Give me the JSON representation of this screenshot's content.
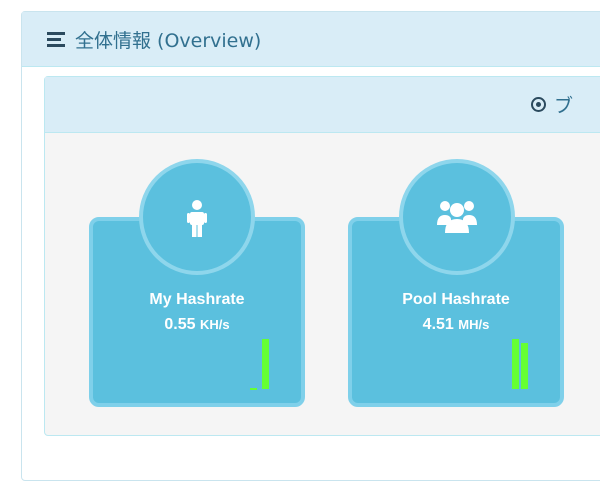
{
  "overview_panel": {
    "title": "全体情報 (Overview)",
    "icon": "list-icon"
  },
  "inner_panel": {
    "title": "ブ",
    "icon": "dot-circle-icon"
  },
  "cards": [
    {
      "label": "My Hashrate",
      "value": "0.55",
      "unit": "KH/s",
      "icon": "user-icon"
    },
    {
      "label": "Pool Hashrate",
      "value": "4.51",
      "unit": "MH/s",
      "icon": "users-icon"
    }
  ],
  "colors": {
    "panel_header_bg": "#d9edf7",
    "panel_header_text": "#31708f",
    "card_bg": "#5bc0de",
    "card_border": "#7fd0ea",
    "sparkline": "#66ff33"
  }
}
